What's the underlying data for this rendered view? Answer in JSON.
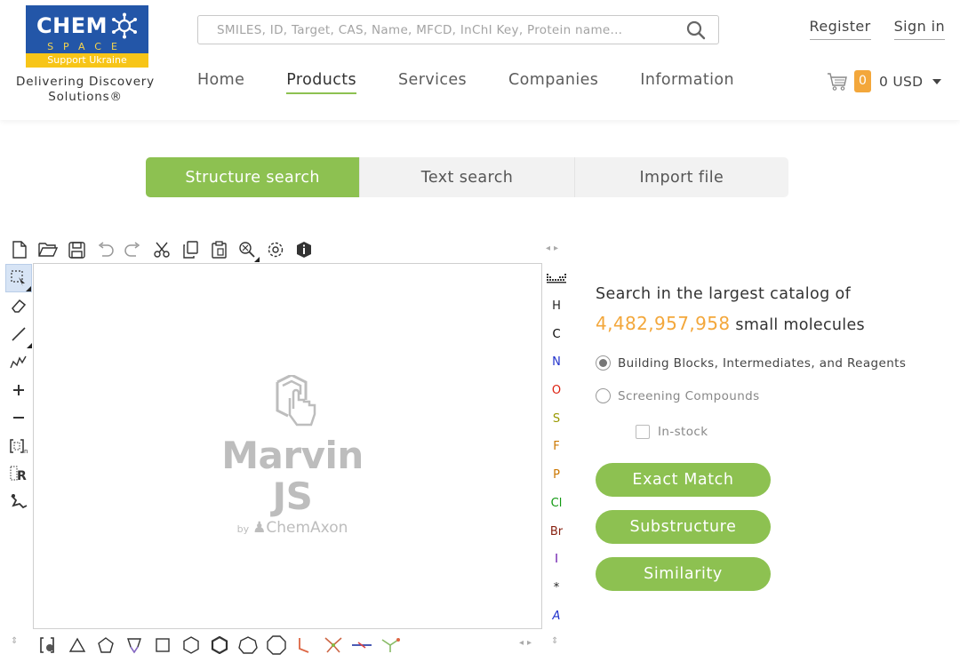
{
  "brand": {
    "logo_word": "CHEM",
    "logo_space": "SPACE",
    "logo_ukraine": "Support Ukraine",
    "tagline_line1": "Delivering Discovery",
    "tagline_line2": "Solutions®",
    "colors": {
      "primary_blue": "#2356a8",
      "yellow": "#f7c518",
      "accent_green": "#8dc151",
      "accent_orange": "#f3a73b"
    }
  },
  "search": {
    "placeholder": "SMILES, ID, Target, CAS, Name, MFCD, InChI Key, Protein name...",
    "icon": "search-icon"
  },
  "nav": {
    "items": [
      {
        "label": "Home",
        "active": false
      },
      {
        "label": "Products",
        "active": true
      },
      {
        "label": "Services",
        "active": false
      },
      {
        "label": "Companies",
        "active": false
      },
      {
        "label": "Information",
        "active": false
      }
    ]
  },
  "auth": {
    "register": "Register",
    "sign_in": "Sign in"
  },
  "cart": {
    "count": "0",
    "total": "0 USD",
    "icon": "cart-icon"
  },
  "tabs": [
    {
      "label": "Structure search",
      "active": true
    },
    {
      "label": "Text search",
      "active": false
    },
    {
      "label": "Import file",
      "active": false
    }
  ],
  "editor": {
    "title": "Marvin JS",
    "by": "by",
    "vendor": "ChemAxon",
    "top_tools": [
      "new-document-icon",
      "open-folder-icon",
      "save-icon",
      "undo-icon",
      "redo-icon",
      "cut-icon",
      "copy-icon",
      "paste-icon",
      "zoom-icon",
      "settings-gear-icon",
      "info-icon"
    ],
    "left_tools": [
      "rectangle-select-icon",
      "eraser-icon",
      "single-bond-icon",
      "chain-icon",
      "charge-plus-icon",
      "charge-minus-icon",
      "sgroup-bracket-icon",
      "rgroup-icon",
      "reaction-arrow-icon"
    ],
    "atoms": [
      {
        "symbol": "H",
        "color": "#222222"
      },
      {
        "symbol": "C",
        "color": "#000000"
      },
      {
        "symbol": "N",
        "color": "#2233cc"
      },
      {
        "symbol": "O",
        "color": "#dd2211"
      },
      {
        "symbol": "S",
        "color": "#999900"
      },
      {
        "symbol": "F",
        "color": "#cc7700"
      },
      {
        "symbol": "P",
        "color": "#cc7700"
      },
      {
        "symbol": "Cl",
        "color": "#119911"
      },
      {
        "symbol": "Br",
        "color": "#882211"
      },
      {
        "symbol": "I",
        "color": "#6611aa"
      },
      {
        "symbol": "*",
        "color": "#222222"
      },
      {
        "symbol": "A",
        "color": "#2233cc"
      }
    ],
    "bottom_tools": [
      "template-library-icon",
      "triangle-ring-icon",
      "pentagon-ring-icon",
      "cyclopentane-envelope-icon",
      "square-ring-icon",
      "hexagon-ring-icon",
      "benzene-ring-icon",
      "heptagon-ring-icon",
      "octagon-ring-icon",
      "l-template-icon",
      "ring-template-icon",
      "chain-template-icon",
      "y-template-icon"
    ]
  },
  "panel": {
    "headline": "Search in the largest catalog of",
    "count": "4,482,957,958",
    "count_suffix": "small molecules",
    "options": [
      {
        "label": "Building Blocks, Intermediates, and Reagents",
        "checked": true
      },
      {
        "label": "Screening Compounds",
        "checked": false
      }
    ],
    "in_stock_label": "In-stock",
    "buttons": {
      "exact": "Exact Match",
      "substructure": "Substructure",
      "similarity": "Similarity"
    }
  }
}
